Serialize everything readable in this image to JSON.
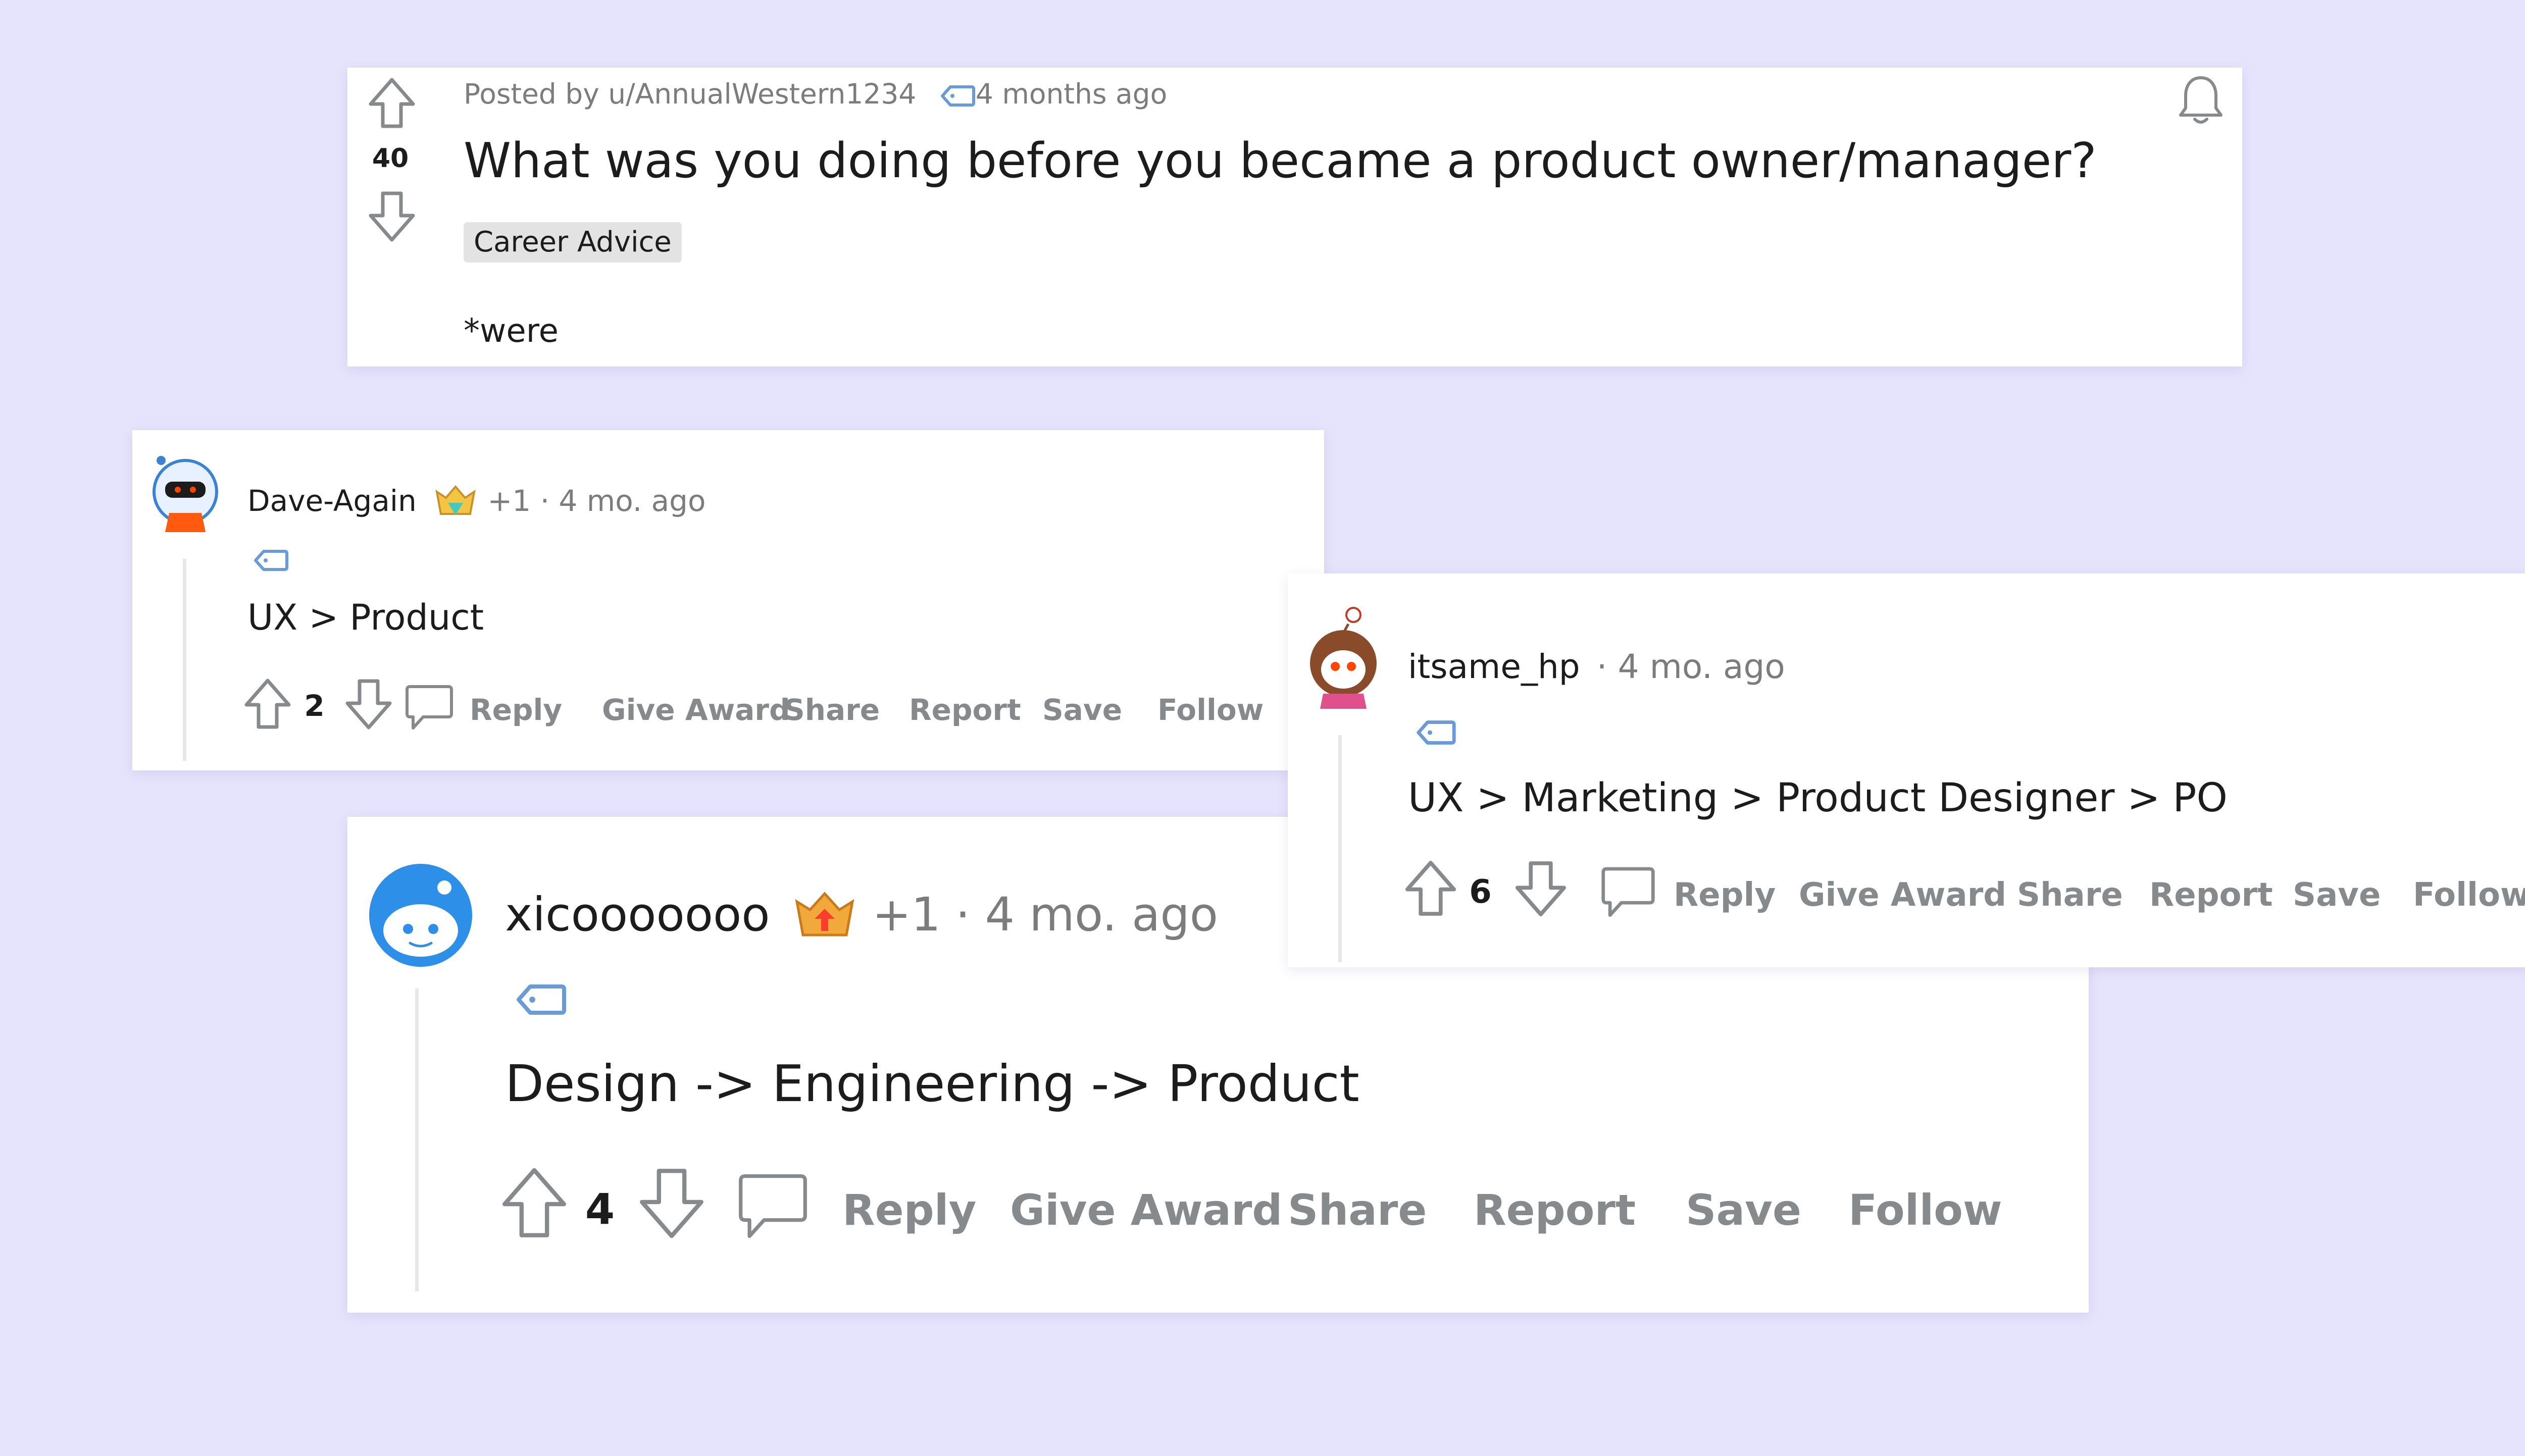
{
  "post": {
    "votes": "40",
    "posted_by": "Posted by u/AnnualWestern1234",
    "time": "4 months ago",
    "title": "What was you doing before you became a product owner/manager?",
    "flair": "Career Advice",
    "body": "*were"
  },
  "comments": [
    {
      "author": "Dave-Again",
      "extra": "+1",
      "time": "· 4 mo. ago",
      "text": "UX > Product",
      "votes": "2",
      "actions": [
        "Reply",
        "Give Award",
        "Share",
        "Report",
        "Save",
        "Follow"
      ]
    },
    {
      "author": "itsame_hp",
      "time": "· 4 mo. ago",
      "text": "UX > Marketing > Product Designer > PO",
      "votes": "6",
      "actions": [
        "Reply",
        "Give Award",
        "Share",
        "Report",
        "Save",
        "Follow"
      ]
    },
    {
      "author": "xicooooooo",
      "extra": "+1",
      "time": "· 4 mo. ago",
      "text": "Design -> Engineering -> Product",
      "votes": "4",
      "actions": [
        "Reply",
        "Give Award",
        "Share",
        "Report",
        "Save",
        "Follow"
      ]
    }
  ],
  "colors": {
    "background": "#e6e3fc",
    "card": "#ffffff",
    "flair_bg": "#e3e3e3",
    "tag_icon": "#6a9ad8",
    "action_text": "#878a8c"
  },
  "icons": [
    "upvote-icon",
    "downvote-icon",
    "bell-icon",
    "tag-icon",
    "comment-icon",
    "award-icon",
    "avatar"
  ]
}
